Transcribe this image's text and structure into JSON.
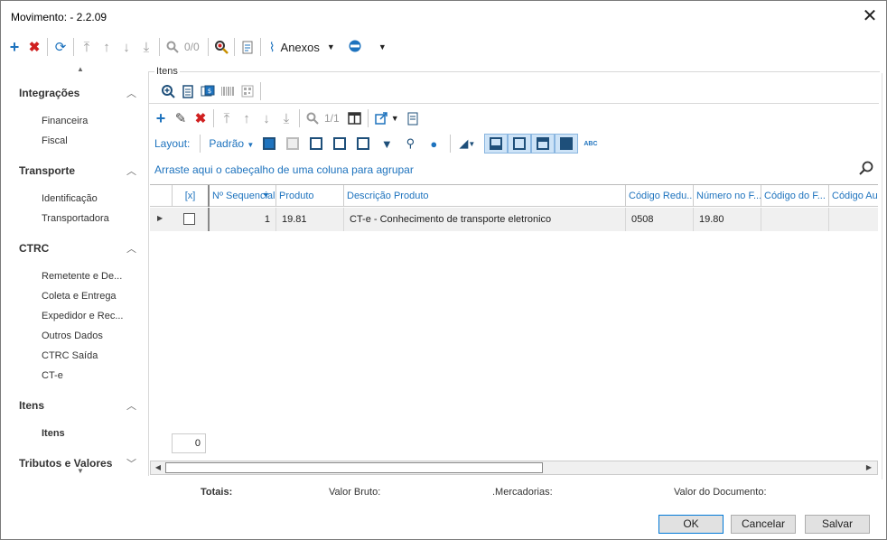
{
  "window": {
    "title": "Movimento:  - 2.2.09"
  },
  "toolbar": {
    "page_counter": "0/0",
    "anexos_label": "Anexos"
  },
  "sidebar": {
    "sections": [
      {
        "title": "Integrações",
        "items": [
          "Financeira",
          "Fiscal"
        ]
      },
      {
        "title": "Transporte",
        "items": [
          "Identificação",
          "Transportadora"
        ]
      },
      {
        "title": "CTRC",
        "items": [
          "Remetente e De...",
          "Coleta e Entrega",
          "Expedidor e Rec...",
          "Outros Dados",
          "CTRC Saída",
          "CT-e"
        ]
      },
      {
        "title": "Itens",
        "items": [
          "Itens"
        ]
      },
      {
        "title": "Tributos e Valores",
        "items": []
      }
    ]
  },
  "panel": {
    "title": "Itens",
    "page_counter": "1/1",
    "layout_label": "Layout:",
    "layout_value": "Padrão",
    "group_hint": "Arraste aqui o cabeçalho de uma coluna para agrupar",
    "columns": [
      "[x]",
      "Nº Sequencial",
      "Produto",
      "Descrição Produto",
      "Código Redu...",
      "Número no F...",
      "Código do F...",
      "Código Aux..."
    ],
    "rows": [
      {
        "seq": "1",
        "produto": "19.81",
        "descricao": "CT-e - Conhecimento de transporte eletronico",
        "codigo_reduzido": "0508",
        "numero_fab": "19.80",
        "codigo_fab": "",
        "codigo_aux": ""
      }
    ],
    "row_count": "0"
  },
  "totals": {
    "label": "Totais:",
    "valor_bruto": "Valor Bruto:",
    "mercadorias": ".Mercadorias:",
    "valor_documento": "Valor do Documento:"
  },
  "buttons": {
    "ok": "OK",
    "cancel": "Cancelar",
    "save": "Salvar"
  }
}
